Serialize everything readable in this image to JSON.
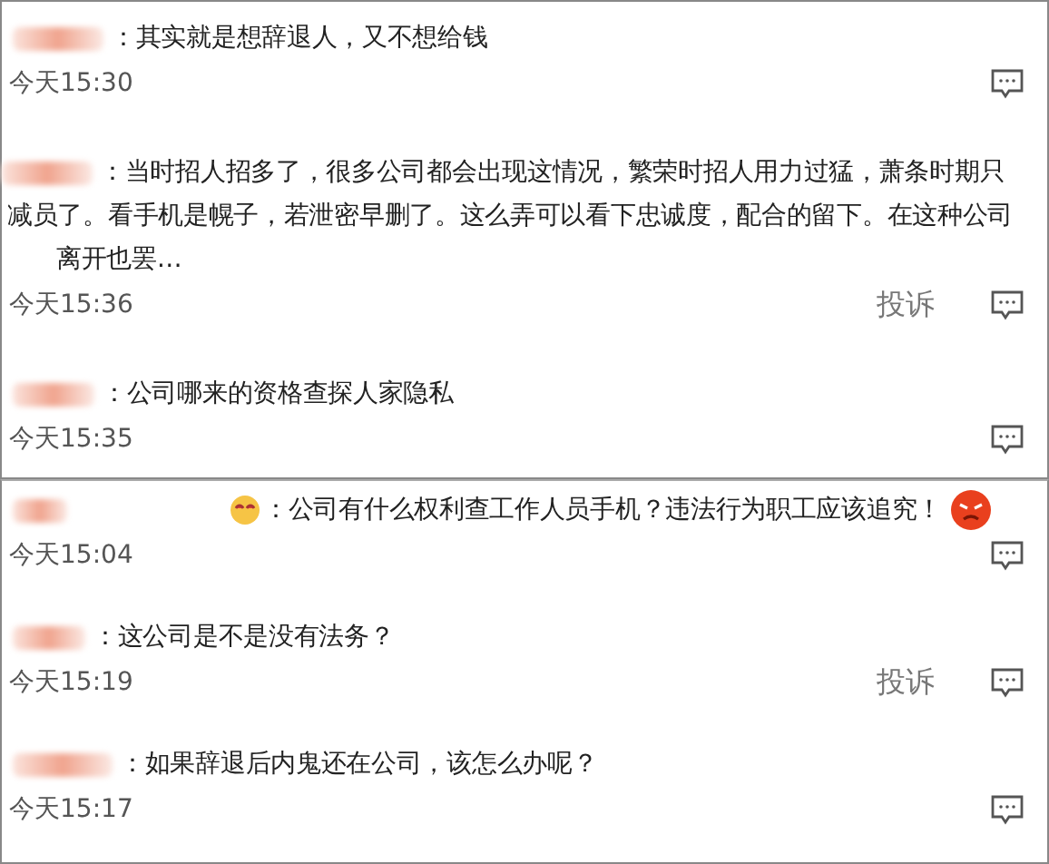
{
  "panels": [
    {
      "comments": [
        {
          "lines": [
            "：其实就是想辞退人，又不想给钱"
          ],
          "time": "今天15:30",
          "lead_emoji": false,
          "trail_emoji": false
        },
        {
          "lines": [
            "：当时招人招多了，很多公司都会出现这情况，繁荣时招人用力过猛，萧条时期只",
            "减员了。看手机是幌子，若泄密早删了。这么弄可以看下忠诚度，配合的留下。在这种公司",
            "离开也罢…"
          ],
          "time": "今天15:36",
          "report": "投诉",
          "lead_emoji": false,
          "trail_emoji": false
        },
        {
          "lines": [
            "：公司哪来的资格查探人家隐私"
          ],
          "time": "今天15:35",
          "lead_emoji": false,
          "trail_emoji": false
        }
      ]
    },
    {
      "comments": [
        {
          "lines": [
            "：公司有什么权利查工作人员手机？违法行为职工应该追究！"
          ],
          "time": "今天15:04",
          "lead_emoji": true,
          "trail_emoji": true
        },
        {
          "lines": [
            "：这公司是不是没有法务？"
          ],
          "time": "今天15:19",
          "report": "投诉",
          "lead_emoji": false,
          "trail_emoji": false
        },
        {
          "lines": [
            "：如果辞退后内鬼还在公司，该怎么办呢？"
          ],
          "time": "今天15:17",
          "lead_emoji": false,
          "trail_emoji": false
        }
      ]
    }
  ]
}
